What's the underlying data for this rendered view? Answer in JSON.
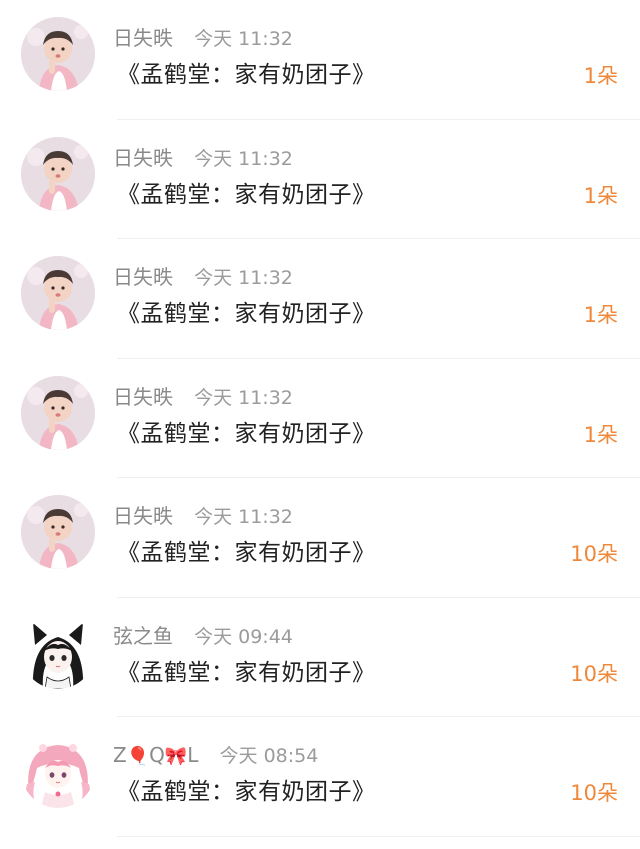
{
  "colors": {
    "name": "#8a8a8a",
    "time": "#9b9b9b",
    "title": "#222222",
    "count": "#f0883a",
    "divider": "#efefef"
  },
  "items": [
    {
      "avatar": "child-photo-avatar",
      "name": "日失昳",
      "time": "今天 11:32",
      "title": "《孟鹤堂：家有奶团子》",
      "count": "1朵"
    },
    {
      "avatar": "child-photo-avatar",
      "name": "日失昳",
      "time": "今天 11:32",
      "title": "《孟鹤堂：家有奶团子》",
      "count": "1朵"
    },
    {
      "avatar": "child-photo-avatar",
      "name": "日失昳",
      "time": "今天 11:32",
      "title": "《孟鹤堂：家有奶团子》",
      "count": "1朵"
    },
    {
      "avatar": "child-photo-avatar",
      "name": "日失昳",
      "time": "今天 11:32",
      "title": "《孟鹤堂：家有奶团子》",
      "count": "1朵"
    },
    {
      "avatar": "child-photo-avatar",
      "name": "日失昳",
      "time": "今天 11:32",
      "title": "《孟鹤堂：家有奶团子》",
      "count": "10朵"
    },
    {
      "avatar": "anime-cat-girl-avatar",
      "name": "弦之鱼",
      "time": "今天 09:44",
      "title": "《孟鹤堂：家有奶团子》",
      "count": "10朵"
    },
    {
      "avatar": "anime-pink-hair-girl-avatar",
      "name_parts": [
        "Z",
        "🎈",
        "Q",
        "🎀",
        "L"
      ],
      "time": "今天 08:54",
      "title": "《孟鹤堂：家有奶团子》",
      "count": "10朵"
    }
  ]
}
